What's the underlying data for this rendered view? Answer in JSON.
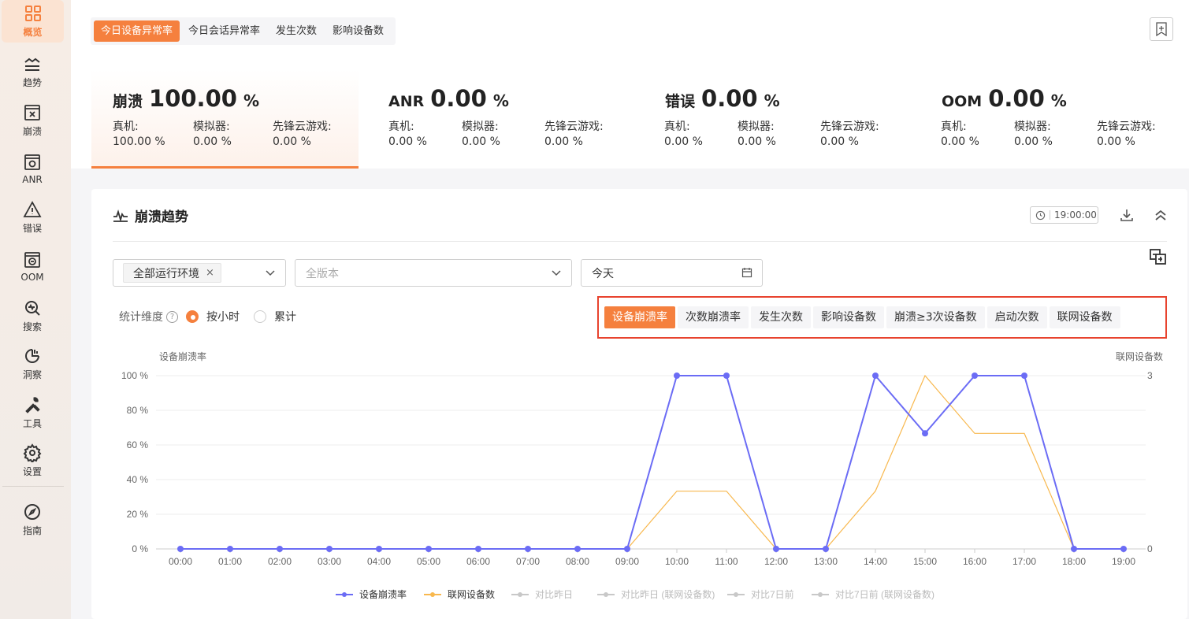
{
  "sidebar": {
    "items": [
      {
        "label": "概览",
        "icon": "dashboard-icon"
      },
      {
        "label": "趋势",
        "icon": "trend-icon"
      },
      {
        "label": "崩溃",
        "icon": "crash-icon"
      },
      {
        "label": "ANR",
        "icon": "anr-icon"
      },
      {
        "label": "错误",
        "icon": "warning-icon"
      },
      {
        "label": "OOM",
        "icon": "oom-icon"
      },
      {
        "label": "搜索",
        "icon": "search-icon"
      },
      {
        "label": "洞察",
        "icon": "insight-icon"
      },
      {
        "label": "工具",
        "icon": "tools-icon"
      },
      {
        "label": "设置",
        "icon": "gear-icon"
      },
      {
        "label": "指南",
        "icon": "compass-icon"
      }
    ]
  },
  "header": {
    "tabs": [
      "今日设备异常率",
      "今日会话异常率",
      "发生次数",
      "影响设备数"
    ]
  },
  "stats": [
    {
      "name": "崩溃",
      "value": "100.00",
      "unit": "%",
      "subs": [
        {
          "label": "真机:",
          "value": "100.00 %"
        },
        {
          "label": "模拟器:",
          "value": "0.00 %"
        },
        {
          "label": "先锋云游戏:",
          "value": "0.00 %"
        }
      ]
    },
    {
      "name": "ANR",
      "value": "0.00",
      "unit": "%",
      "subs": [
        {
          "label": "真机:",
          "value": "0.00 %"
        },
        {
          "label": "模拟器:",
          "value": "0.00 %"
        },
        {
          "label": "先锋云游戏:",
          "value": "0.00 %"
        }
      ]
    },
    {
      "name": "错误",
      "value": "0.00",
      "unit": "%",
      "subs": [
        {
          "label": "真机:",
          "value": "0.00 %"
        },
        {
          "label": "模拟器:",
          "value": "0.00 %"
        },
        {
          "label": "先锋云游戏:",
          "value": "0.00 %"
        }
      ]
    },
    {
      "name": "OOM",
      "value": "0.00",
      "unit": "%",
      "subs": [
        {
          "label": "真机:",
          "value": "0.00 %"
        },
        {
          "label": "模拟器:",
          "value": "0.00 %"
        },
        {
          "label": "先锋云游戏:",
          "value": "0.00 %"
        }
      ]
    }
  ],
  "card": {
    "title": "崩溃趋势",
    "time_badge": "19:00:00",
    "env_chip": "全部运行环境",
    "version_placeholder": "全版本",
    "date_value": "今天",
    "dim_label": "统计维度",
    "radio_hourly": "按小时",
    "radio_cumulative": "累计",
    "metrics": [
      "设备崩溃率",
      "次数崩溃率",
      "发生次数",
      "影响设备数",
      "崩溃≥3次设备数",
      "启动次数",
      "联网设备数"
    ]
  },
  "colors": {
    "accent": "#f5803e",
    "series1": "#6b6cf5",
    "series2": "#f8b84e",
    "compare": "#c8c8c8",
    "highlight": "#e8432e"
  },
  "chart_data": {
    "type": "line",
    "ylabel_left": "设备崩溃率",
    "ylabel_right": "联网设备数",
    "x": [
      "00:00",
      "01:00",
      "02:00",
      "03:00",
      "04:00",
      "05:00",
      "06:00",
      "07:00",
      "08:00",
      "09:00",
      "10:00",
      "11:00",
      "12:00",
      "13:00",
      "14:00",
      "15:00",
      "16:00",
      "17:00",
      "18:00",
      "19:00"
    ],
    "yticks_left": [
      "100 %",
      "80 %",
      "60 %",
      "40 %",
      "20 %",
      "0 %"
    ],
    "yticks_right": [
      "3",
      "0"
    ],
    "ylim_left": [
      0,
      100
    ],
    "ylim_right": [
      0,
      3
    ],
    "series": [
      {
        "name": "设备崩溃率",
        "axis": "left",
        "values": [
          0,
          0,
          0,
          0,
          0,
          0,
          0,
          0,
          0,
          0,
          100,
          100,
          0,
          0,
          100,
          66.7,
          100,
          100,
          0,
          0
        ]
      },
      {
        "name": "联网设备数",
        "axis": "right",
        "values": [
          0,
          0,
          0,
          0,
          0,
          0,
          0,
          0,
          0,
          0,
          1,
          1,
          0,
          0,
          1,
          3,
          2,
          2,
          0,
          null
        ]
      }
    ],
    "legend": [
      "设备崩溃率",
      "联网设备数",
      "对比昨日",
      "对比昨日 (联网设备数)",
      "对比7日前",
      "对比7日前 (联网设备数)"
    ],
    "legend_position": "bottom-center",
    "grid": true
  }
}
